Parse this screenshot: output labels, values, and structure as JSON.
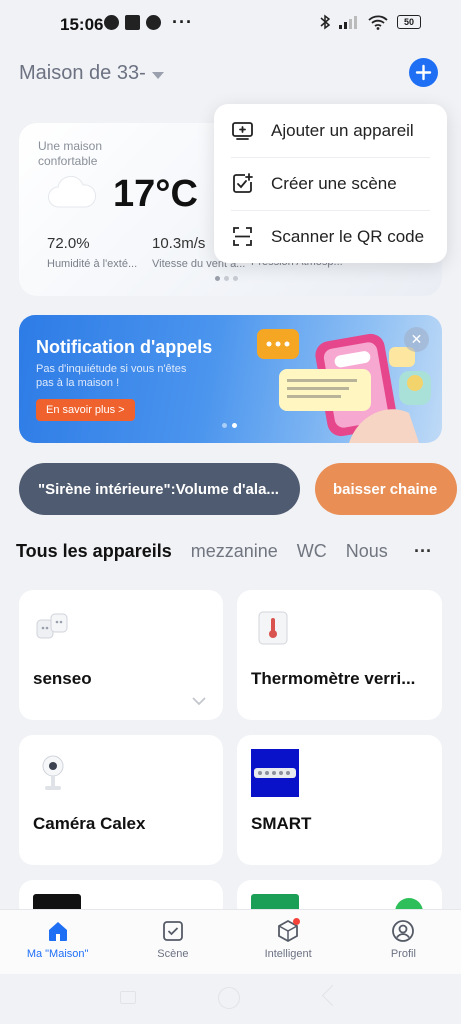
{
  "status_bar": {
    "time": "15:06",
    "battery": "50"
  },
  "header": {
    "home_name": "Maison de 33-"
  },
  "weather": {
    "caption": "Une maison confortable",
    "temperature": "17°C",
    "stats": [
      {
        "value": "72.0%",
        "label": "Humidité à l'exté..."
      },
      {
        "value": "10.3m/s",
        "label": "Vitesse du vent a..."
      },
      {
        "value": "",
        "label": "Pression Atmosp..."
      }
    ]
  },
  "add_menu": {
    "items": [
      {
        "label": "Ajouter un appareil",
        "icon": "add-device-icon"
      },
      {
        "label": "Créer une scène",
        "icon": "create-scene-icon"
      },
      {
        "label": "Scanner le QR code",
        "icon": "qr-scan-icon"
      }
    ]
  },
  "banner": {
    "title": "Notification d'appels",
    "subtitle": "Pas d'inquiétude si vous n'êtes pas à la maison !",
    "button": "En savoir plus >"
  },
  "scene_chips": [
    "\"Sirène intérieure\":Volume d'ala...",
    "baisser chaine"
  ],
  "room_tabs": [
    "Tous les appareils",
    "mezzanine",
    "WC",
    "Nous"
  ],
  "devices": [
    {
      "name": "senseo",
      "icon": "smart-plug-icon"
    },
    {
      "name": "Thermomètre verri...",
      "icon": "thermometer-icon"
    },
    {
      "name": "Caméra Calex",
      "icon": "camera-icon"
    },
    {
      "name": "SMART",
      "icon": "power-strip-icon"
    }
  ],
  "bottom_tabs": [
    "Ma \"Maison\"",
    "Scène",
    "Intelligent",
    "Profil"
  ],
  "colors": {
    "accent": "#1f6ff5",
    "chip_dark": "#4f5b70",
    "chip_orange": "#e98e55",
    "banner_button": "#f0622d"
  }
}
